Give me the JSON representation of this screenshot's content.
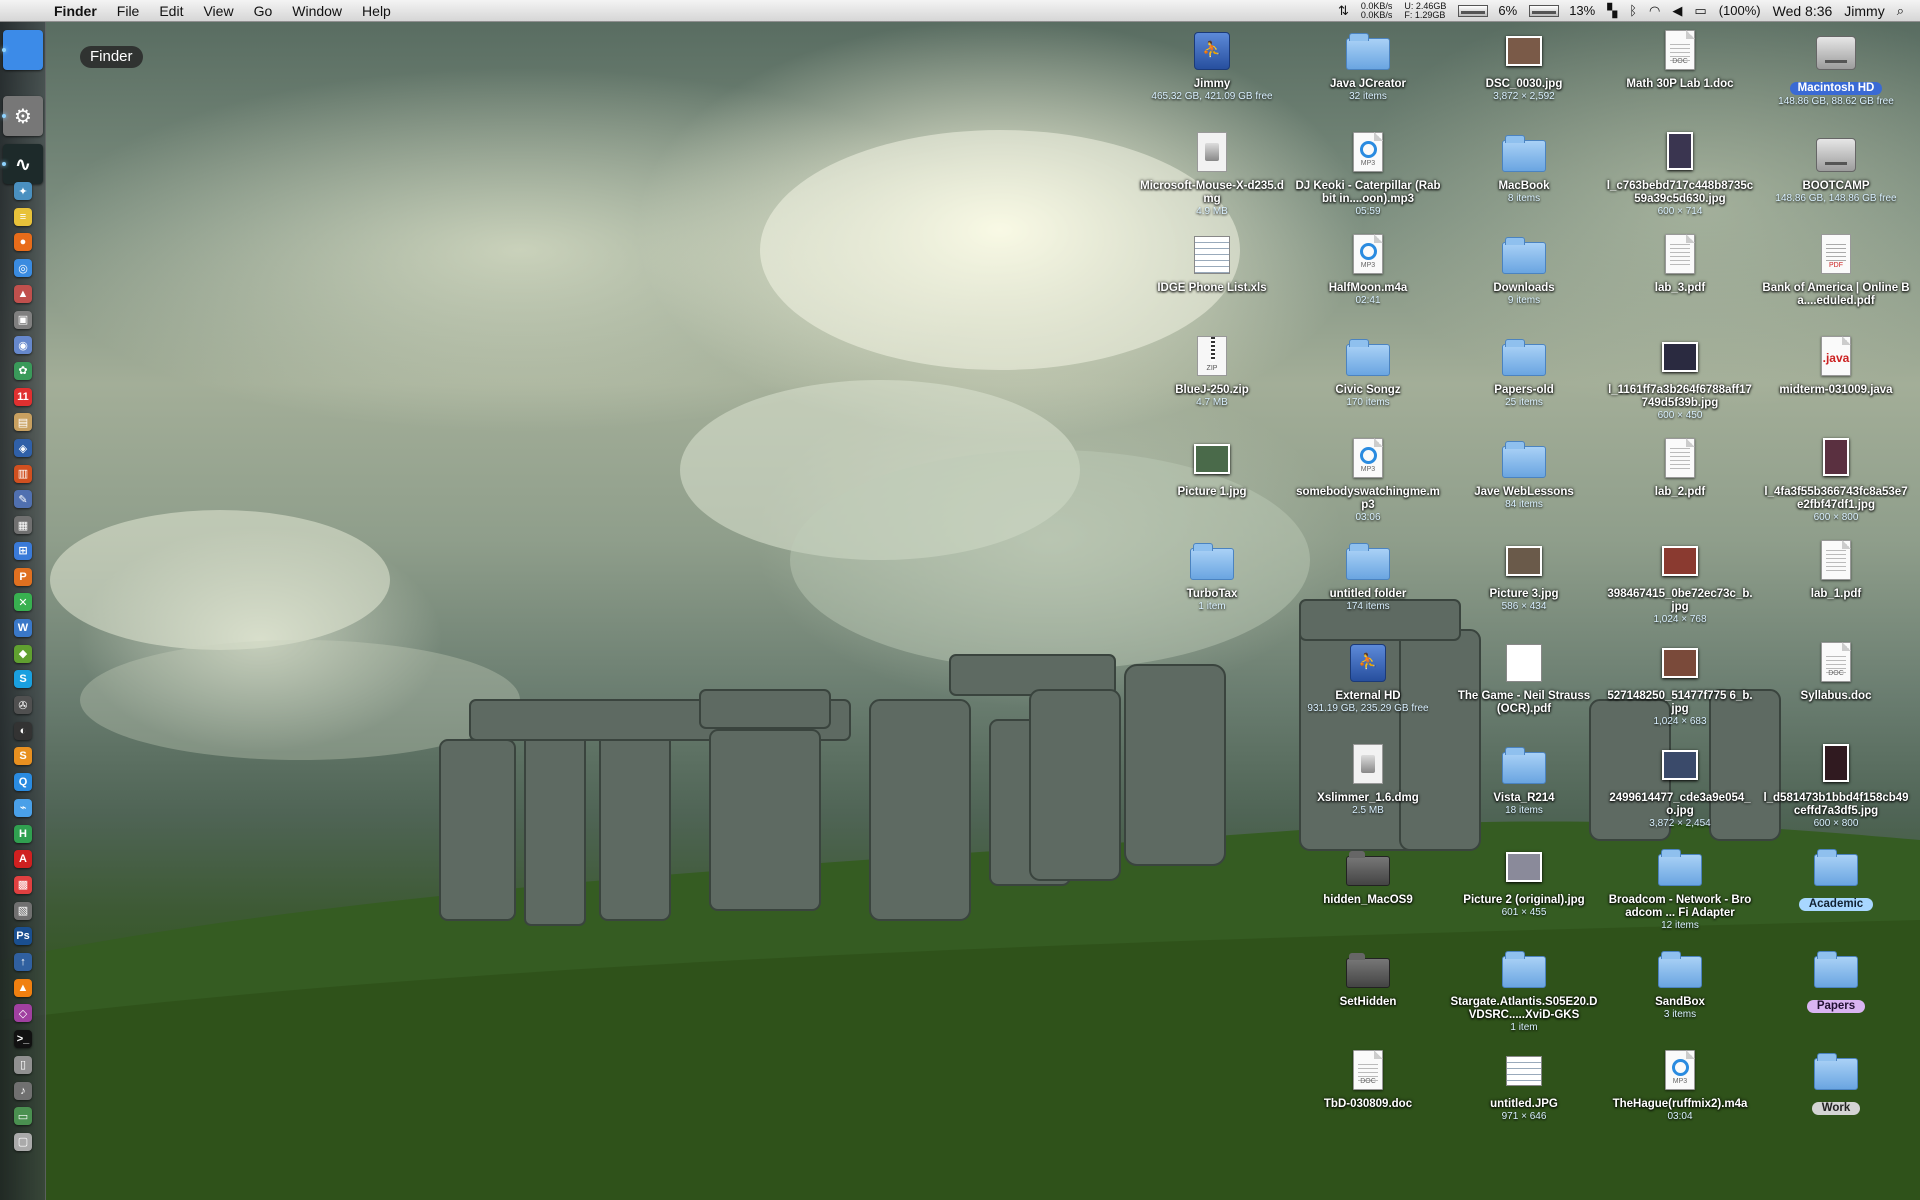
{
  "menubar": {
    "apple": "",
    "app": "Finder",
    "menus": [
      "File",
      "Edit",
      "View",
      "Go",
      "Window",
      "Help"
    ],
    "status": {
      "net_up": "0.0KB/s",
      "net_down": "0.0KB/s",
      "mem_u": "U: 2.46GB",
      "mem_f": "F: 1.29GB",
      "cpu1": "6%",
      "cpu2": "13%",
      "battery": "(100%)",
      "clock": "Wed 8:36",
      "user": "Jimmy"
    }
  },
  "dock": {
    "tooltip": "Finder",
    "items": [
      {
        "icon": "finder-icon",
        "color": "#3c8be8",
        "glyph": ""
      },
      {
        "icon": "system-preferences-icon",
        "color": "#777777",
        "glyph": "⚙"
      },
      {
        "icon": "activity-monitor-icon",
        "color": "#1d2a2a",
        "glyph": "∿"
      },
      {
        "icon": "app-icon",
        "color": "#4a90c0",
        "glyph": "✦"
      },
      {
        "icon": "stickies-icon",
        "color": "#e8c23a",
        "glyph": "≡"
      },
      {
        "icon": "firefox-icon",
        "color": "#e86c1a",
        "glyph": "●"
      },
      {
        "icon": "safari-icon",
        "color": "#3a8be0",
        "glyph": "◎"
      },
      {
        "icon": "app-icon",
        "color": "#c0504d",
        "glyph": "▲"
      },
      {
        "icon": "app-icon",
        "color": "#808080",
        "glyph": "▣"
      },
      {
        "icon": "app-icon",
        "color": "#6688cc",
        "glyph": "◉"
      },
      {
        "icon": "app-icon",
        "color": "#3a9a5a",
        "glyph": "✿"
      },
      {
        "icon": "ical-icon",
        "color": "#e03030",
        "glyph": "11"
      },
      {
        "icon": "app-icon",
        "color": "#c8a060",
        "glyph": "▤"
      },
      {
        "icon": "app-icon",
        "color": "#3060a8",
        "glyph": "◈"
      },
      {
        "icon": "app-icon",
        "color": "#d05020",
        "glyph": "▥"
      },
      {
        "icon": "app-icon",
        "color": "#5070b0",
        "glyph": "✎"
      },
      {
        "icon": "app-icon",
        "color": "#707070",
        "glyph": "▦"
      },
      {
        "icon": "windows-icon",
        "color": "#3a7ad8",
        "glyph": "⊞"
      },
      {
        "icon": "app-icon",
        "color": "#e07020",
        "glyph": "P"
      },
      {
        "icon": "app-icon",
        "color": "#38b050",
        "glyph": "✕"
      },
      {
        "icon": "app-icon",
        "color": "#3a78c8",
        "glyph": "W"
      },
      {
        "icon": "app-icon",
        "color": "#60a030",
        "glyph": "◆"
      },
      {
        "icon": "skype-icon",
        "color": "#1aa0e0",
        "glyph": "S"
      },
      {
        "icon": "app-icon",
        "color": "#505050",
        "glyph": "✇"
      },
      {
        "icon": "app-icon",
        "color": "#333333",
        "glyph": "◐"
      },
      {
        "icon": "app-icon",
        "color": "#e89020",
        "glyph": "S"
      },
      {
        "icon": "quicktime-icon",
        "color": "#2a8be0",
        "glyph": "Q"
      },
      {
        "icon": "app-icon",
        "color": "#4aa0e8",
        "glyph": "⌁"
      },
      {
        "icon": "app-icon",
        "color": "#30a050",
        "glyph": "H"
      },
      {
        "icon": "acrobat-icon",
        "color": "#d02020",
        "glyph": "A"
      },
      {
        "icon": "app-icon",
        "color": "#e04040",
        "glyph": "▩"
      },
      {
        "icon": "app-icon",
        "color": "#707070",
        "glyph": "▧"
      },
      {
        "icon": "photoshop-icon",
        "color": "#1a4f90",
        "glyph": "Ps"
      },
      {
        "icon": "app-icon",
        "color": "#3060a0",
        "glyph": "↑"
      },
      {
        "icon": "vlc-icon",
        "color": "#f08010",
        "glyph": "▲"
      },
      {
        "icon": "app-icon",
        "color": "#a040a0",
        "glyph": "◇"
      },
      {
        "icon": "terminal-icon",
        "color": "#111111",
        "glyph": ">_"
      },
      {
        "icon": "app-icon",
        "color": "#909090",
        "glyph": "▯"
      },
      {
        "icon": "app-icon",
        "color": "#707070",
        "glyph": "♪"
      },
      {
        "icon": "app-icon",
        "color": "#4a9050",
        "glyph": "▭"
      },
      {
        "icon": "app-icon",
        "color": "#aaaaaa",
        "glyph": "▢"
      }
    ]
  },
  "desktop": {
    "icons": [
      {
        "name": "Jimmy",
        "sub": "465.32 GB, 421.09 GB free",
        "type": "netdrive"
      },
      {
        "name": "Java JCreator",
        "sub": "32 items",
        "type": "folder"
      },
      {
        "name": "DSC_0030.jpg",
        "sub": "3,872 × 2,592",
        "type": "photo",
        "tint": "#7a5a48"
      },
      {
        "name": "Math 30P Lab 1.doc",
        "sub": "",
        "type": "doc",
        "tag": "DOC"
      },
      {
        "name": "Macintosh HD",
        "sub": "148.86 GB, 88.62 GB free",
        "type": "drive",
        "highlight": true
      },
      {
        "name": "Microsoft-Mouse-X-d235.dmg",
        "sub": "4.9 MB",
        "type": "dmg"
      },
      {
        "name": "DJ Keoki - Caterpillar (Rabbit in....oon).mp3",
        "sub": "05:59",
        "type": "mp3"
      },
      {
        "name": "MacBook",
        "sub": "8 items",
        "type": "folder"
      },
      {
        "name": "l_c763bebd717c448b8735c59a39c5d630.jpg",
        "sub": "600 × 714",
        "type": "photo-tall",
        "tint": "#3a3550"
      },
      {
        "name": "BOOTCAMP",
        "sub": "148.86 GB, 148.86 GB free",
        "type": "drive"
      },
      {
        "name": "IDGE Phone List.xls",
        "sub": "",
        "type": "sheet"
      },
      {
        "name": "HalfMoon.m4a",
        "sub": "02:41",
        "type": "mp3"
      },
      {
        "name": "Downloads",
        "sub": "9 items",
        "type": "folder"
      },
      {
        "name": "lab_3.pdf",
        "sub": "",
        "type": "doclines"
      },
      {
        "name": "Bank of America | Online Ba....eduled.pdf",
        "sub": "",
        "type": "pdf"
      },
      {
        "name": "BlueJ-250.zip",
        "sub": "4.7 MB",
        "type": "zip"
      },
      {
        "name": "Civic Songz",
        "sub": "170 items",
        "type": "folder"
      },
      {
        "name": "Papers-old",
        "sub": "25 items",
        "type": "folder"
      },
      {
        "name": "l_1161ff7a3b264f6788aff17749d5f39b.jpg",
        "sub": "600 × 450",
        "type": "photo",
        "tint": "#2a2a40"
      },
      {
        "name": "midterm-031009.java",
        "sub": "",
        "type": "java"
      },
      {
        "name": "Picture 1.jpg",
        "sub": "",
        "type": "photo",
        "tint": "#4a6a4a"
      },
      {
        "name": "somebodyswatchingme.mp3",
        "sub": "03:06",
        "type": "mp3"
      },
      {
        "name": "Jave WebLessons",
        "sub": "84 items",
        "type": "folder"
      },
      {
        "name": "lab_2.pdf",
        "sub": "",
        "type": "doclines"
      },
      {
        "name": "l_4fa3f55b366743fc8a53e7e2fbf47df1.jpg",
        "sub": "600 × 800",
        "type": "photo-tall",
        "tint": "#5a3040"
      },
      {
        "name": "TurboTax",
        "sub": "1 item",
        "type": "folder"
      },
      {
        "name": "untitled folder",
        "sub": "174 items",
        "type": "folder"
      },
      {
        "name": "Picture 3.jpg",
        "sub": "586 × 434",
        "type": "photo",
        "tint": "#6a5a4a"
      },
      {
        "name": "398467415_0be72ec73c_b.jpg",
        "sub": "1,024 × 768",
        "type": "photo",
        "tint": "#8a3a30"
      },
      {
        "name": "lab_1.pdf",
        "sub": "",
        "type": "doclines"
      },
      {
        "name": "External HD",
        "sub": "931.19 GB, 235.29 GB free",
        "type": "netdrive"
      },
      {
        "name": "The Game - Neil Strauss (OCR).pdf",
        "sub": "",
        "type": "pdfwide"
      },
      {
        "name": "527148250_51477f775 6_b.jpg",
        "sub": "1,024 × 683",
        "type": "photo",
        "tint": "#7a4a3a"
      },
      {
        "name": "Syllabus.doc",
        "sub": "",
        "type": "doc",
        "tag": "DOC"
      },
      {
        "name": "Xslimmer_1.6.dmg",
        "sub": "2.5 MB",
        "type": "dmg"
      },
      {
        "name": "Vista_R214",
        "sub": "18 items",
        "type": "folder"
      },
      {
        "name": "2499614477_cde3a9e054_o.jpg",
        "sub": "3,872 × 2,454",
        "type": "photo",
        "tint": "#3a4a6a"
      },
      {
        "name": "l_d581473b1bbd4f158cb49ceffd7a3df5.jpg",
        "sub": "600 × 800",
        "type": "photo-tall",
        "tint": "#301a20"
      },
      {
        "name": "hidden_MacOS9",
        "sub": "",
        "type": "gray"
      },
      {
        "name": "Picture 2 (original).jpg",
        "sub": "601 × 455",
        "type": "photo",
        "tint": "#8a8a9a"
      },
      {
        "name": "Broadcom - Network - Broadcom ... Fi Adapter",
        "sub": "12 items",
        "type": "folder"
      },
      {
        "name": "Academic",
        "sub": "",
        "type": "folder",
        "tag": "blue"
      },
      {
        "name": "SetHidden",
        "sub": "",
        "type": "gray"
      },
      {
        "name": "Stargate.Atlantis.S05E20.DVDSRC.....XviD-GKS",
        "sub": "1 item",
        "type": "folder"
      },
      {
        "name": "SandBox",
        "sub": "3 items",
        "type": "folder"
      },
      {
        "name": "Papers",
        "sub": "",
        "type": "folder",
        "tag": "purple"
      },
      {
        "name": "TbD-030809.doc",
        "sub": "",
        "type": "doc",
        "tag": "DOC"
      },
      {
        "name": "untitled.JPG",
        "sub": "971 × 646",
        "type": "sheetwide"
      },
      {
        "name": "TheHague(ruffmix2).m4a",
        "sub": "03:04",
        "type": "mp3"
      },
      {
        "name": "Work",
        "sub": "",
        "type": "folder",
        "tag": "gray"
      }
    ]
  }
}
